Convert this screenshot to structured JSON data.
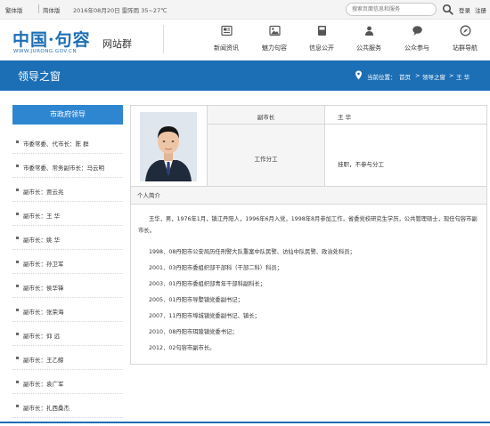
{
  "topbar": {
    "traditional": "繁体版",
    "simplified": "简体版",
    "date_weather": "2016年08月20日  雷阵雨 35~27℃",
    "search_placeholder": "搜索页面信息和服务",
    "login": "登录",
    "register": "注册"
  },
  "header": {
    "logo_text": "中国·句容",
    "logo_url": "WWW.JURONG.GOV.CN",
    "logo_sub": "网站群",
    "nav": [
      {
        "label": "新闻资讯",
        "icon": "newspaper-icon"
      },
      {
        "label": "魅力句容",
        "icon": "picture-icon"
      },
      {
        "label": "信息公开",
        "icon": "book-icon"
      },
      {
        "label": "公共服务",
        "icon": "people-icon"
      },
      {
        "label": "公众参与",
        "icon": "chat-bubble-icon"
      },
      {
        "label": "站群导航",
        "icon": "compass-icon"
      }
    ]
  },
  "band": {
    "title": "领导之窗",
    "breadcrumb_label": "当前位置：",
    "breadcrumb": [
      "首页",
      "领导之窗",
      "王  华"
    ],
    "separator": ">"
  },
  "sidebar": {
    "heading": "市政府领导",
    "items": [
      "市委常委、代市长：陈  群",
      "市委常委、常务副市长：马云明",
      "副市长：贾云兆",
      "副市长：王  华",
      "副市长：姚  华",
      "副市长：孙卫军",
      "副市长：侯华锋",
      "副市长：张荣海",
      "副市长：仰  远",
      "副市长：王乙鲸",
      "副市长：袁广军",
      "副市长：扎西桑杰"
    ]
  },
  "profile": {
    "title_key": "副市长",
    "name": "王  华",
    "duty_key": "工作分工",
    "duty_value": "挂职，不参与分工"
  },
  "bio": {
    "heading": "个人简介",
    "intro": "王华，男，1976年1月，镇江丹阳人，1996年6月入党，1998年8月参加工作，省委党校研究生学历，公共管理硕士，现任句容市副市长。",
    "lines": [
      "1998．08丹阳市公安局历任刑警大队重案中队民警、访仙中队民警、政治处科员；",
      "2001．03丹阳市委组织部干部科（干部二科）科员；",
      "2003．01丹阳市委组织部青年干部科副科长；",
      "2005．01丹阳市导墅镇党委副书记；",
      "2007．11丹阳市埠城镇党委副书记、镇长；",
      "2010．08丹阳市珥陵镇党委书记；",
      "2012．02句容市副市长。"
    ]
  },
  "colors": {
    "brand_blue": "#1c6fb5",
    "sidebar_head": "#2e86d1"
  }
}
